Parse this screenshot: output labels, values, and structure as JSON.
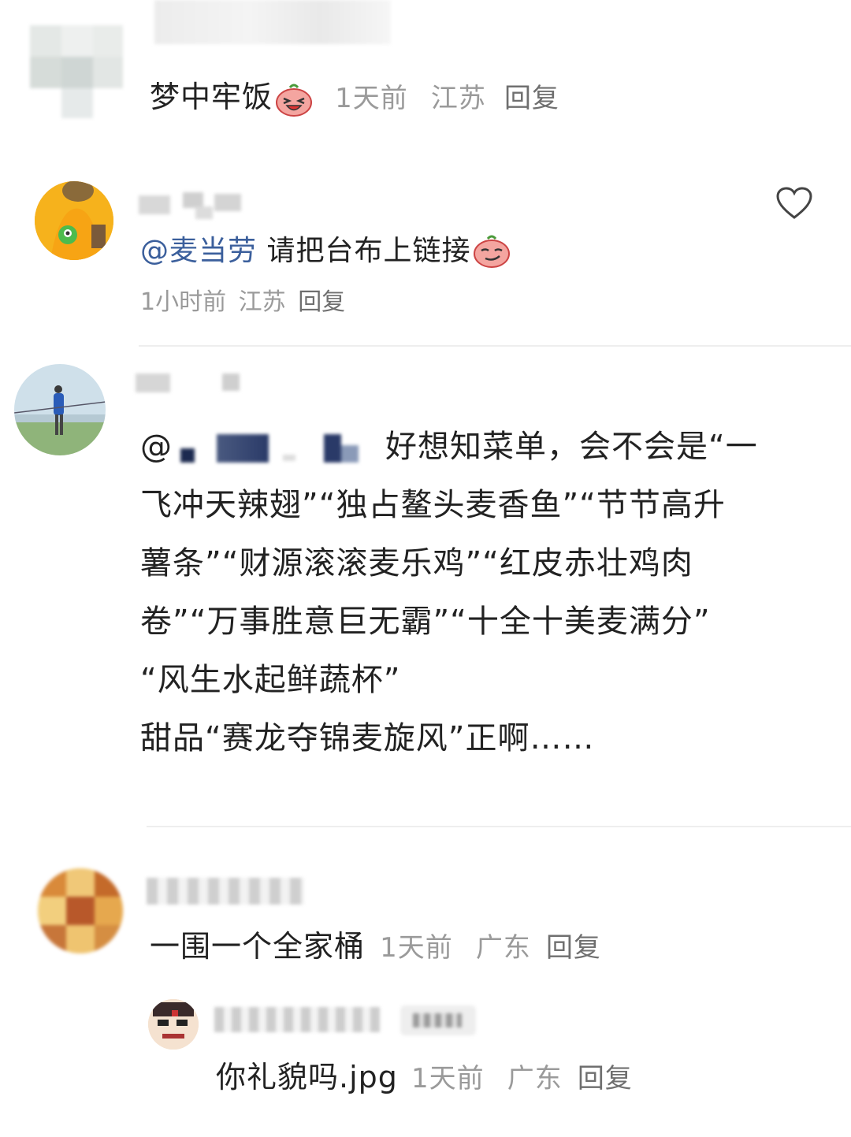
{
  "comment1": {
    "text": "梦中牢饭",
    "emoji": "laughing-face-emoji",
    "time": "1天前",
    "location": "江苏",
    "reply": "回复"
  },
  "comment2": {
    "mention": "@麦当劳",
    "text": " 请把台布上链接",
    "emoji": "smirk-face-emoji",
    "time": "1小时前",
    "location": "江苏",
    "reply": "回复"
  },
  "comment3": {
    "at": "@",
    "lines": [
      "好想知菜单，会不会是“一",
      "飞冲天辣翅”“独占鳌头麦香鱼”“节节高升",
      "薯条”“财源滚滚麦乐鸡”“红皮赤壮鸡肉",
      "卷”“万事胜意巨无霸”“十全十美麦满分”",
      "“风生水起鲜蔬杯”",
      "甜品“赛龙夺锦麦旋风”正啊……"
    ]
  },
  "comment4": {
    "text": "一围一个全家桶",
    "time": "1天前",
    "location": "广东",
    "reply": "回复"
  },
  "reply1": {
    "text": "你礼貌吗.jpg",
    "time": "1天前",
    "location": "广东",
    "reply": "回复"
  },
  "colors": {
    "mention": "#3b5f9c",
    "meta": "#9a9a9a",
    "divider": "#eeeeee"
  }
}
